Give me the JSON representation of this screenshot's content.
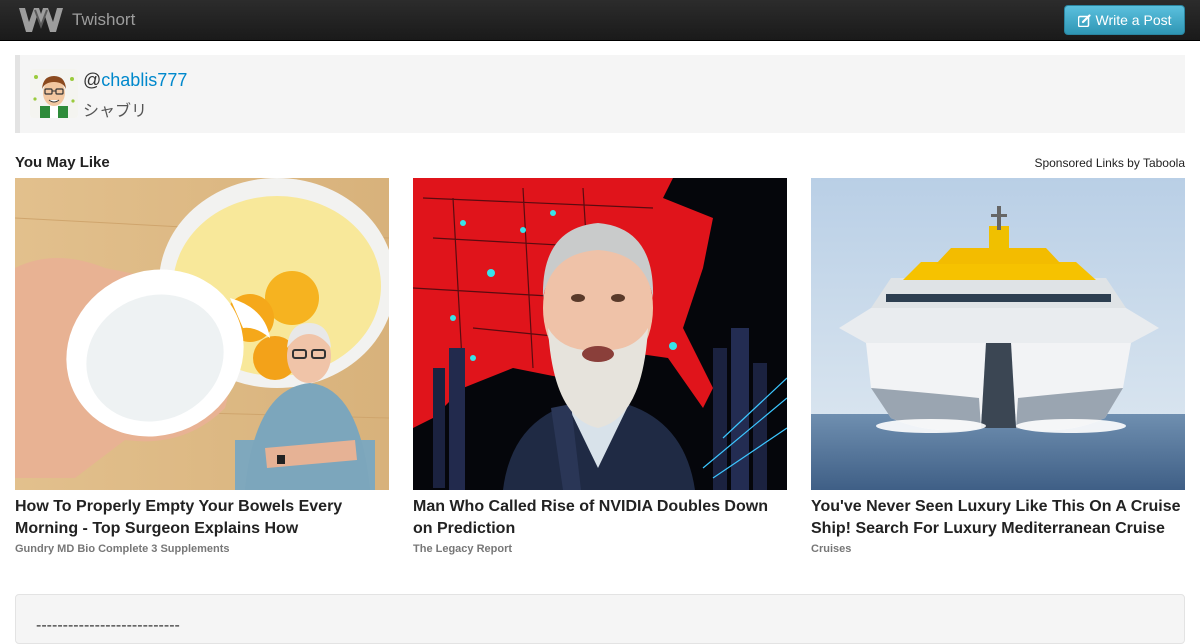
{
  "navbar": {
    "brand_name": "Twishort",
    "write_button_label": "Write a Post",
    "logo_icon": "twishort-logo-icon",
    "write_icon": "edit-icon"
  },
  "user": {
    "at": "@",
    "handle": "chablis777",
    "nickname": "シャブリ"
  },
  "recommendations": {
    "heading": "You May Like",
    "sponsored_label": "Sponsored Links by Taboola",
    "cards": [
      {
        "title": "How To Properly Empty Your Bowels Every Morning - Top Surgeon Explains How",
        "source": "Gundry MD Bio Complete 3 Supplements"
      },
      {
        "title": "Man Who Called Rise of NVIDIA Doubles Down on Prediction",
        "source": "The Legacy Report"
      },
      {
        "title": "You've Never Seen Luxury Like This On A Cruise Ship! Search For Luxury Mediterranean Cruise",
        "source": "Cruises"
      }
    ]
  },
  "post": {
    "text": "---------------------------"
  },
  "colors": {
    "navbar": "#222222",
    "button": "#49afcd",
    "link": "#0088cc"
  }
}
